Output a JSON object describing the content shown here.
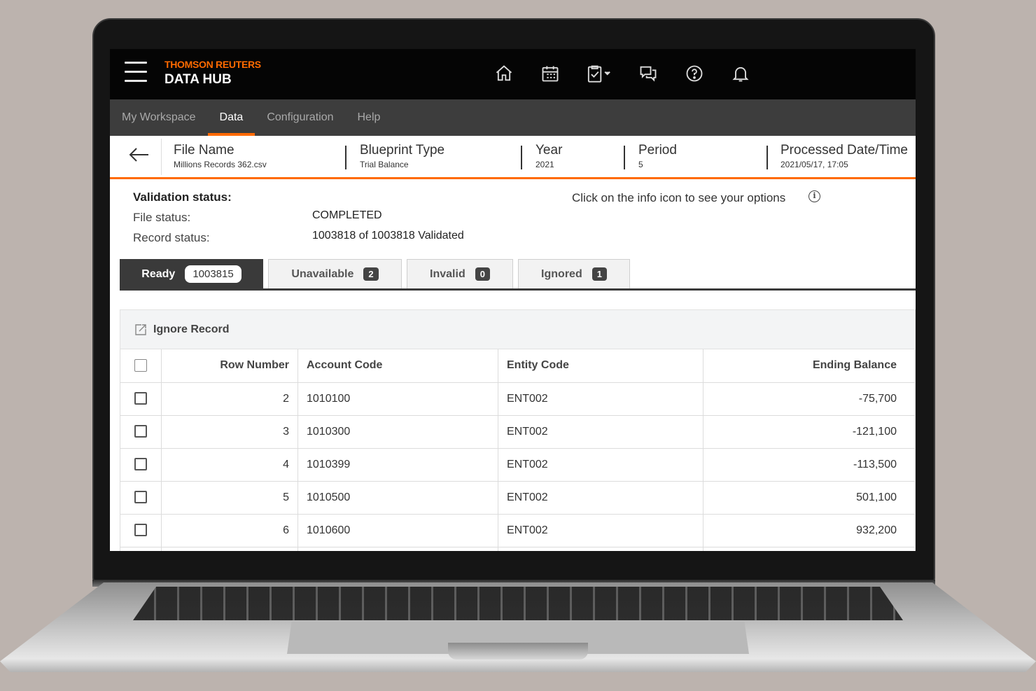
{
  "brand": {
    "company": "THOMSON REUTERS",
    "product": "DATA HUB"
  },
  "header_icons": [
    "home-icon",
    "calendar-icon",
    "clipboard-check-icon",
    "chat-icon",
    "help-icon",
    "bell-icon"
  ],
  "nav": {
    "items": [
      {
        "label": "My Workspace",
        "active": false
      },
      {
        "label": "Data",
        "active": true
      },
      {
        "label": "Configuration",
        "active": false
      },
      {
        "label": "Help",
        "active": false
      }
    ]
  },
  "file_info": {
    "file_name_label": "File Name",
    "file_name": "Millions Records 362.csv",
    "blueprint_label": "Blueprint Type",
    "blueprint": "Trial Balance",
    "year_label": "Year",
    "year": "2021",
    "period_label": "Period",
    "period": "5",
    "processed_label": "Processed Date/Time",
    "processed": "2021/05/17, 17:05"
  },
  "validation": {
    "title": "Validation status:",
    "file_status_label": "File status:",
    "file_status": "COMPLETED",
    "record_status_label": "Record status:",
    "record_status": "1003818 of 1003818 Validated",
    "hint": "Click on the info icon to see your options"
  },
  "tabs": [
    {
      "label": "Ready",
      "count": "1003815",
      "active": true
    },
    {
      "label": "Unavailable",
      "count": "2",
      "active": false
    },
    {
      "label": "Invalid",
      "count": "0",
      "active": false
    },
    {
      "label": "Ignored",
      "count": "1",
      "active": false
    }
  ],
  "toolbar": {
    "ignore_label": "Ignore Record"
  },
  "table": {
    "columns": [
      "Row Number",
      "Account Code",
      "Entity Code",
      "Ending Balance"
    ],
    "rows": [
      {
        "row": "2",
        "account": "1010100",
        "entity": "ENT002",
        "balance": "-75,700"
      },
      {
        "row": "3",
        "account": "1010300",
        "entity": "ENT002",
        "balance": "-121,100"
      },
      {
        "row": "4",
        "account": "1010399",
        "entity": "ENT002",
        "balance": "-113,500"
      },
      {
        "row": "5",
        "account": "1010500",
        "entity": "ENT002",
        "balance": "501,100"
      },
      {
        "row": "6",
        "account": "1010600",
        "entity": "ENT002",
        "balance": "932,200"
      },
      {
        "row": "",
        "account": "",
        "entity": "",
        "balance": ""
      }
    ]
  }
}
